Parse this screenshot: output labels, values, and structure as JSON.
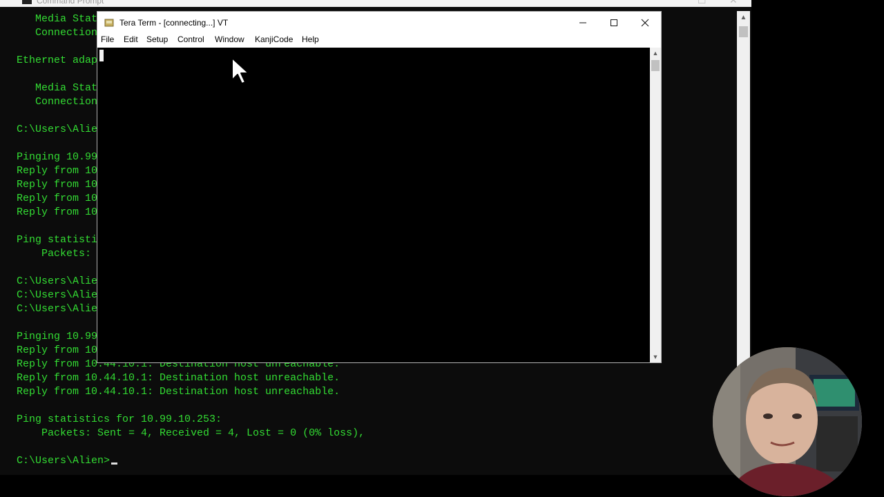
{
  "cmd": {
    "title": "Command Prompt",
    "lines": [
      {
        "text": "   Media State",
        "color": "green"
      },
      {
        "text": "   Connection",
        "color": "green"
      },
      {
        "text": "",
        "color": "green"
      },
      {
        "text": "Ethernet adap",
        "color": "green"
      },
      {
        "text": "",
        "color": "green"
      },
      {
        "text": "   Media State",
        "color": "green"
      },
      {
        "text": "   Connection",
        "color": "green"
      },
      {
        "text": "",
        "color": "green"
      },
      {
        "text": "C:\\Users\\Alie",
        "color": "green"
      },
      {
        "text": "",
        "color": "green"
      },
      {
        "text": "Pinging 10.99",
        "color": "green"
      },
      {
        "text": "Reply from 10",
        "color": "green"
      },
      {
        "text": "Reply from 10",
        "color": "green"
      },
      {
        "text": "Reply from 10",
        "color": "green"
      },
      {
        "text": "Reply from 10",
        "color": "green"
      },
      {
        "text": "",
        "color": "green"
      },
      {
        "text": "Ping statisti",
        "color": "green"
      },
      {
        "text": "    Packets:",
        "color": "green"
      },
      {
        "text": "",
        "color": "green"
      },
      {
        "text": "C:\\Users\\Alie",
        "color": "green"
      },
      {
        "text": "C:\\Users\\Alie",
        "color": "green"
      },
      {
        "text": "C:\\Users\\Alie",
        "color": "green"
      },
      {
        "text": "",
        "color": "green"
      },
      {
        "text": "Pinging 10.99",
        "color": "green"
      },
      {
        "text": "Reply from 10",
        "color": "green"
      },
      {
        "text": "Reply from 10.44.10.1: Destination host unreachable.",
        "color": "green"
      },
      {
        "text": "Reply from 10.44.10.1: Destination host unreachable.",
        "color": "green"
      },
      {
        "text": "Reply from 10.44.10.1: Destination host unreachable.",
        "color": "green"
      },
      {
        "text": "",
        "color": "green"
      },
      {
        "text": "Ping statistics for 10.99.10.253:",
        "color": "green"
      },
      {
        "text": "    Packets: Sent = 4, Received = 4, Lost = 0 (0% loss),",
        "color": "green"
      },
      {
        "text": "",
        "color": "green"
      }
    ],
    "prompt": "C:\\Users\\Alien>"
  },
  "teraterm": {
    "title": "Tera Term - [connecting...] VT",
    "menu": [
      "File",
      "Edit",
      "Setup",
      "Control",
      "Window",
      "KanjiCode",
      "Help"
    ]
  },
  "colors": {
    "terminal_green": "#33dd33",
    "terminal_bg": "#0c0c0c",
    "window_chrome": "#ffffff"
  }
}
